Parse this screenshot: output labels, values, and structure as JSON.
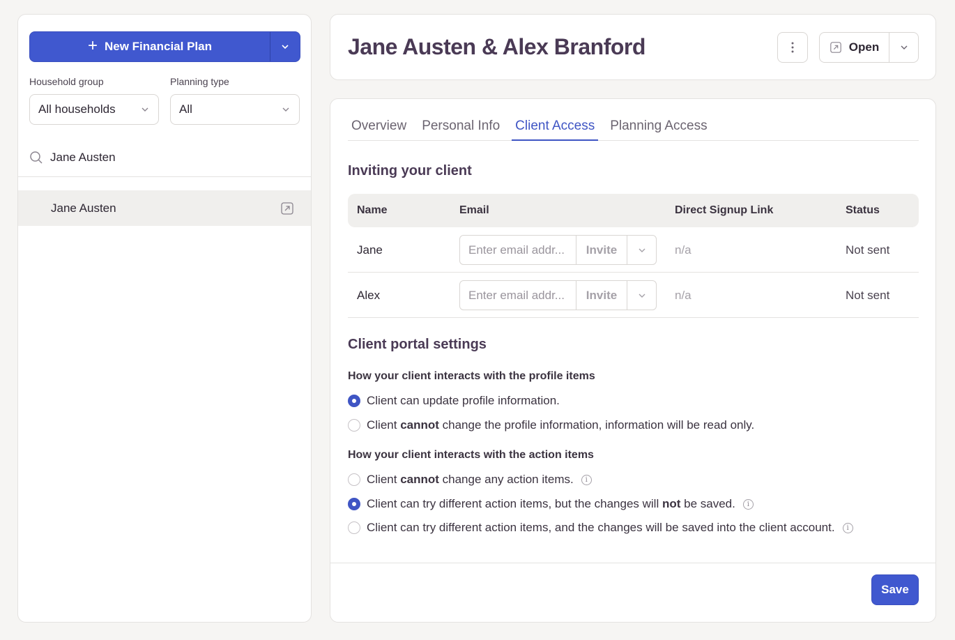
{
  "sidebar": {
    "new_plan_label": "New Financial Plan",
    "household_label": "Household group",
    "household_value": "All households",
    "planning_label": "Planning type",
    "planning_value": "All",
    "search_value": "Jane Austen",
    "results": [
      {
        "name": "Jane Austen"
      }
    ]
  },
  "header": {
    "title": "Jane Austen & Alex Branford",
    "open_label": "Open"
  },
  "tabs": [
    {
      "label": "Overview"
    },
    {
      "label": "Personal Info"
    },
    {
      "label": "Client Access",
      "active": true
    },
    {
      "label": "Planning Access"
    }
  ],
  "invite_section": {
    "title": "Inviting your client",
    "columns": [
      "Name",
      "Email",
      "Direct Signup Link",
      "Status"
    ],
    "rows": [
      {
        "name": "Jane",
        "email_placeholder": "Enter email addr...",
        "invite_label": "Invite",
        "link": "n/a",
        "status": "Not sent"
      },
      {
        "name": "Alex",
        "email_placeholder": "Enter email addr...",
        "invite_label": "Invite",
        "link": "n/a",
        "status": "Not sent"
      }
    ]
  },
  "portal_settings": {
    "title": "Client portal settings",
    "profile_heading": "How your client interacts with the profile items",
    "profile_options": [
      {
        "pre": "Client can update profile information.",
        "bold": "",
        "post": "",
        "checked": true
      },
      {
        "pre": "Client ",
        "bold": "cannot",
        "post": " change the profile information, information will be read only.",
        "checked": false
      }
    ],
    "action_heading": "How your client interacts with the action items",
    "action_options": [
      {
        "pre": "Client ",
        "bold": "cannot",
        "post": " change any action items.",
        "checked": false,
        "info": true
      },
      {
        "pre": "Client can try different action items, but the changes will ",
        "bold": "not",
        "post": " be saved.",
        "checked": true,
        "info": true
      },
      {
        "pre": "Client can try different action items, and the changes will be saved into the client account.",
        "bold": "",
        "post": "",
        "checked": false,
        "info": true
      }
    ],
    "save_label": "Save"
  },
  "colors": {
    "accent": "#4058cf",
    "title": "#4a3a55",
    "background": "#f6f5f3"
  },
  "icons": [
    "plus-icon",
    "chevron-down-icon",
    "search-icon",
    "external-link-icon",
    "kebab-icon",
    "info-icon"
  ]
}
